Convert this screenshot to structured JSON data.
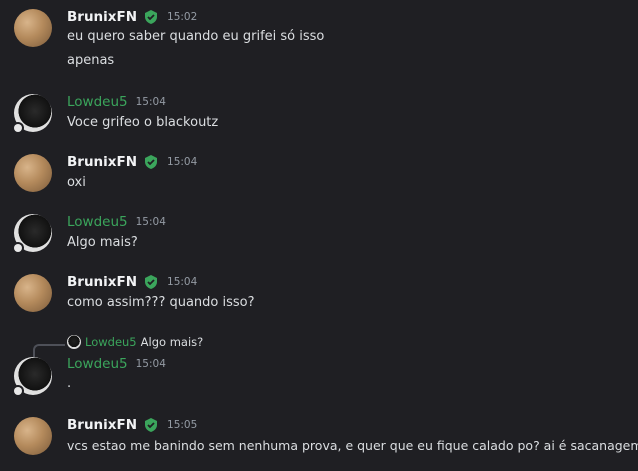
{
  "messages": [
    {
      "author": "BrunixFN",
      "time": "15:02",
      "lines": [
        "eu quero saber quando eu grifei só isso",
        "apenas"
      ]
    },
    {
      "author": "Lowdeu5",
      "time": "15:04",
      "lines": [
        "Voce grifeo o blackoutz"
      ]
    },
    {
      "author": "BrunixFN",
      "time": "15:04",
      "lines": [
        "oxi"
      ]
    },
    {
      "author": "Lowdeu5",
      "time": "15:04",
      "lines": [
        "Algo mais?"
      ]
    },
    {
      "author": "BrunixFN",
      "time": "15:04",
      "lines": [
        "como assim??? quando isso?"
      ]
    },
    {
      "author": "Lowdeu5",
      "time": "15:04",
      "lines": [
        "."
      ],
      "reply": {
        "author": "Lowdeu5",
        "text": "Algo mais?"
      }
    },
    {
      "author": "BrunixFN",
      "time": "15:05",
      "lines": [
        "vcs estao me banindo sem nenhuma prova, e quer que eu fique calado po? ai é sacanagem"
      ]
    }
  ],
  "colors": {
    "background": "#1f1f23",
    "brunix_name": "#f2f3f5",
    "lowdeu_name": "#3ba55c",
    "badge": "#3ba55c",
    "timestamp": "#949ba4"
  },
  "icons": {
    "brunix_badge": "shield-badge-icon",
    "lowdeu_status": "mobile-status-icon"
  }
}
